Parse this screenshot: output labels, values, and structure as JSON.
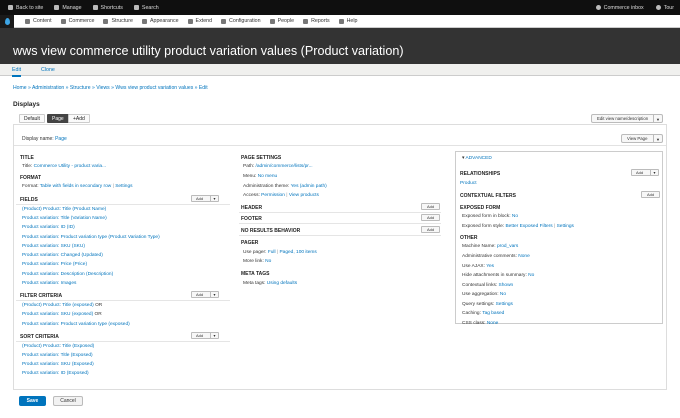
{
  "toolbar": {
    "back": "Back to site",
    "manage": "Manage",
    "shortcuts": "Shortcuts",
    "search": "Search",
    "inbox": "Commerce inbox",
    "tour": "Tour"
  },
  "admin_menu": [
    "Content",
    "Commerce",
    "Structure",
    "Appearance",
    "Extend",
    "Configuration",
    "People",
    "Reports",
    "Help"
  ],
  "page_title": "wws view commerce utility product variation values (Product variation)",
  "tabs": {
    "edit": "Edit",
    "clone": "Clone"
  },
  "breadcrumb": "Home » Administration » Structure » Views » Wws view product variation values » Edit",
  "displays_label": "Displays",
  "display_tabs": {
    "default": "Default",
    "page": "Page",
    "add": "+Add"
  },
  "edit_view_btn": "Edit view name/description",
  "view_page_btn": "View Page",
  "display_name_label": "Display name:",
  "display_name": "Page",
  "left": {
    "title_h": "TITLE",
    "title_label": "Title:",
    "title_val": "Commerce Utility - product varia...",
    "format_h": "FORMAT",
    "format_label": "Format:",
    "format_val": "Table with fields in secondary row",
    "settings": "Settings",
    "sep": "|",
    "fields_h": "FIELDS",
    "add": "Add",
    "fields": [
      "(Product) Product: Title (Product Name)",
      "Product variation: Title (Variation Name)",
      "Product variation: ID (ID)",
      "Product variation: Product variation type (Product Variation Type)",
      "Product variation: SKU (SKU)",
      "Product variation: Changed (Updated)",
      "Product variation: Price (Price)",
      "Product variation: Description (Description)",
      "Product variation: Images"
    ],
    "filter_h": "FILTER CRITERIA",
    "filters": [
      {
        "text": "(Product) Product: Title (exposed)",
        "op": "OR"
      },
      {
        "text": "Product variation: SKU (exposed)",
        "op": "OR"
      },
      {
        "text": "Product variation: Product variation type (exposed)",
        "op": ""
      }
    ],
    "sort_h": "SORT CRITERIA",
    "sorts": [
      "(Product) Product: Title (Exposed)",
      "Product variation: Title (Exposed)",
      "Product variation: SKU (Exposed)",
      "Product variation: ID (Exposed)"
    ]
  },
  "middle": {
    "page_settings_h": "PAGE SETTINGS",
    "path_label": "Path:",
    "path_val": "/admin/commerce/lists/pr...",
    "menu_label": "Menu:",
    "menu_val": "No menu",
    "theme_label": "Administration theme:",
    "theme_val": "Yes (admin path)",
    "access_label": "Access:",
    "access_val": "Permission",
    "access_val2": "View products",
    "sep": "|",
    "header_h": "HEADER",
    "footer_h": "FOOTER",
    "nores_h": "NO RESULTS BEHAVIOR",
    "add": "Add",
    "pager_h": "PAGER",
    "pager_label": "Use pager:",
    "pager_val": "Full",
    "pager_val2": "Paged, 100 items",
    "more_label": "More link:",
    "more_val": "No",
    "meta_h": "META TAGS",
    "meta_label": "Meta tags:",
    "meta_val": "Using defaults"
  },
  "advanced": {
    "toggle": "ADVANCED",
    "relationships_h": "RELATIONSHIPS",
    "add": "Add",
    "product": "Product",
    "ctx_h": "CONTEXTUAL FILTERS",
    "exposed_h": "EXPOSED FORM",
    "block_label": "Exposed form in block:",
    "block_val": "No",
    "style_label": "Exposed form style:",
    "style_val": "Better Exposed Filters",
    "settings": "Settings",
    "sep": "|",
    "other_h": "OTHER",
    "machine_label": "Machine Name:",
    "machine_val": "prod_vars",
    "comments_label": "Administrative comments:",
    "comments_val": "None",
    "ajax_label": "Use AJAX:",
    "ajax_val": "Yes",
    "hide_label": "Hide attachments in summary:",
    "hide_val": "No",
    "ctx_links_label": "Contextual links:",
    "ctx_links_val": "Shown",
    "agg_label": "Use aggregation:",
    "agg_val": "No",
    "query_label": "Query settings:",
    "query_val": "Settings",
    "caching_label": "Caching:",
    "caching_val": "Tag based",
    "css_label": "CSS class:",
    "css_val": "None"
  },
  "save": "Save",
  "cancel": "Cancel",
  "colors": {
    "link": "#0074bd",
    "header_bg": "#333333",
    "toolbar_bg": "#0f0f0f"
  }
}
